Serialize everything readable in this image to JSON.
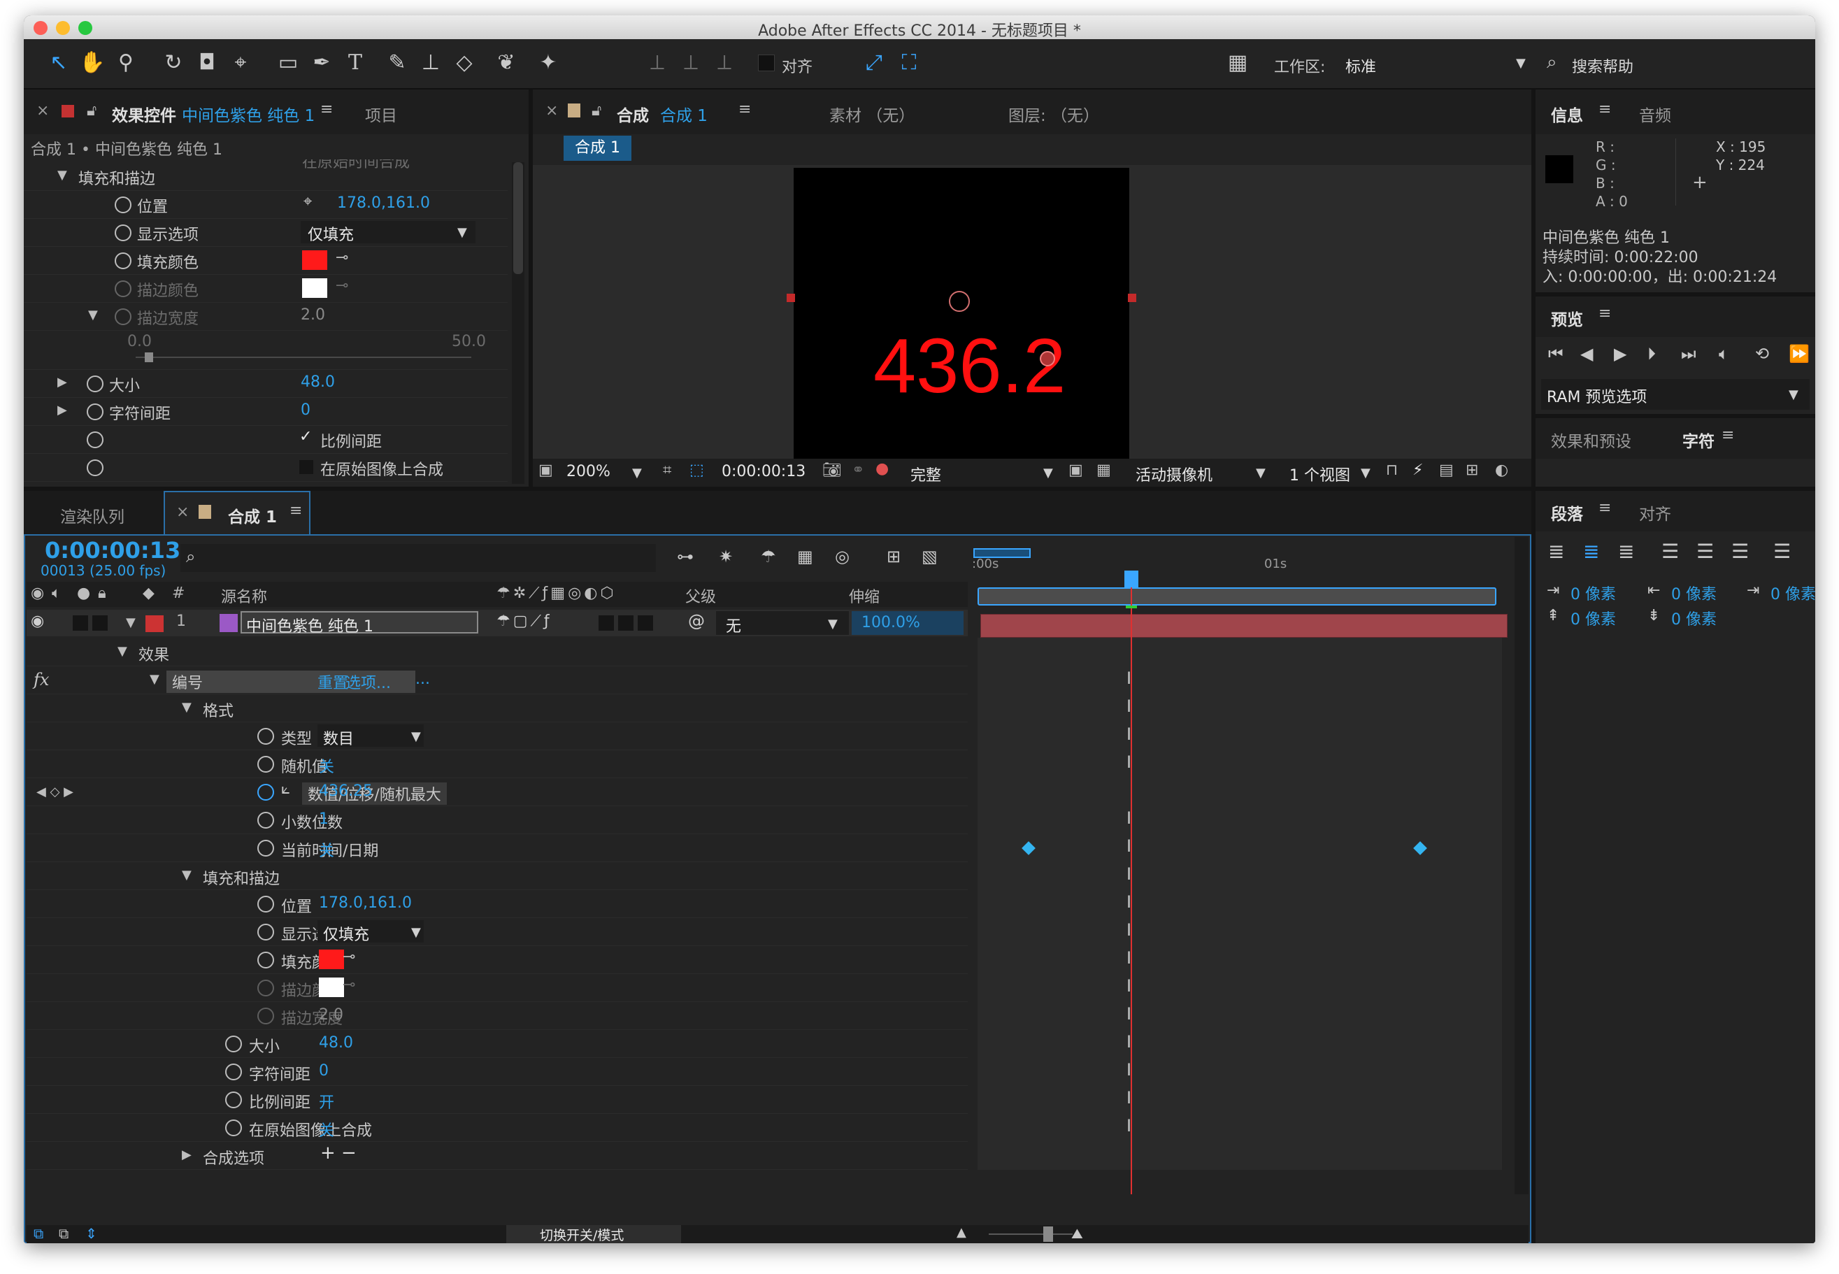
{
  "window": {
    "title": "Adobe After Effects CC 2014 - 无标题项目 *"
  },
  "toolbar": {
    "align_label": "对齐",
    "workspace_label": "工作区:",
    "workspace_value": "标准",
    "search_help": "搜索帮助"
  },
  "effect_controls": {
    "tab_label": "效果控件",
    "tab_layer": "中间色紫色 纯色 1",
    "tab_project": "项目",
    "breadcrumb": "合成 1 • 中间色紫色 纯色 1",
    "cut_text": "在原始时间合成",
    "section_fill_stroke": "填充和描边",
    "position_label": "位置",
    "position_value": "178.0,161.0",
    "display_label": "显示选项",
    "display_value": "仅填充",
    "fill_color_label": "填充颜色",
    "stroke_color_label": "描边颜色",
    "stroke_width_label": "描边宽度",
    "stroke_width_value": "2.0",
    "slider_min": "0.0",
    "slider_max": "50.0",
    "slider_value_fraction": 0.04,
    "size_label": "大小",
    "size_value": "48.0",
    "tracking_label": "字符间距",
    "tracking_value": "0",
    "proportional_label": "比例间距",
    "composite_label": "在原始图像上合成"
  },
  "composition": {
    "tab_label": "合成",
    "tab_name": "合成 1",
    "footage_tab": "素材 （无）",
    "layer_tab": "图层: （无）",
    "chip_label": "合成 1",
    "canvas_text": "436.2",
    "zoom": "200%",
    "timecode": "0:00:00:13",
    "quality": "完整",
    "camera": "活动摄像机",
    "views": "1 个视图"
  },
  "info_panel": {
    "tab_info": "信息",
    "tab_audio": "音频",
    "r_label": "R :",
    "g_label": "G :",
    "b_label": "B :",
    "a_label": "A : 0",
    "x_label": "X : 195",
    "y_label": "Y : 224",
    "layer_name": "中间色紫色 纯色 1",
    "duration": "持续时间: 0:00:22:00",
    "in_out": "入: 0:00:00:00，出: 0:00:21:24"
  },
  "preview_panel": {
    "tab_label": "预览",
    "ram_options": "RAM 预览选项"
  },
  "effects_presets": {
    "tab_label": "效果和预设",
    "tab_character": "字符"
  },
  "paragraph_panel": {
    "tab_label": "段落",
    "tab_align": "对齐",
    "indent_1": "0 像素",
    "indent_2": "0 像素",
    "indent_3": "0 像素",
    "space_1": "0 像素",
    "space_2": "0 像素"
  },
  "timeline": {
    "tab_render_queue": "渲染队列",
    "tab_comp": "合成 1",
    "timecode": "0:00:00:13",
    "frames": "00013 (25.00 fps)",
    "col_num": "#",
    "col_source": "源名称",
    "col_parent": "父级",
    "col_stretch": "伸缩",
    "layer_index": "1",
    "layer_name": "中间色紫色 纯色 1",
    "layer_parent": "无",
    "layer_stretch": "100.0%",
    "ruler_0": ":00s",
    "ruler_1": "01s",
    "toggle_modes": "切换开关/模式",
    "playhead_fraction": 0.295
  },
  "properties": [
    {
      "label": "效果",
      "value": "",
      "indent": 0,
      "twirl": "open",
      "stopwatch": false
    },
    {
      "label": "编号",
      "value": "",
      "indent": 1,
      "twirl": "open",
      "stopwatch": false,
      "selected": true,
      "links": [
        "重置",
        "选项...",
        "..."
      ]
    },
    {
      "label": "格式",
      "value": "",
      "indent": 2,
      "twirl": "open",
      "stopwatch": false
    },
    {
      "label": "类型",
      "value": "数目",
      "indent": 3,
      "stopwatch": true,
      "dropdown": true
    },
    {
      "label": "随机值",
      "value": "关",
      "indent": 3,
      "stopwatch": true
    },
    {
      "label": "数值/位移/随机最大",
      "value": "436.25",
      "indent": 3,
      "stopwatch": true,
      "keyframed": true
    },
    {
      "label": "小数位数",
      "value": "1",
      "indent": 3,
      "stopwatch": true
    },
    {
      "label": "当前时间/日期",
      "value": "关",
      "indent": 3,
      "stopwatch": true
    },
    {
      "label": "填充和描边",
      "value": "",
      "indent": 2,
      "twirl": "open",
      "stopwatch": false
    },
    {
      "label": "位置",
      "value": "178.0,161.0",
      "indent": 3,
      "stopwatch": true
    },
    {
      "label": "显示选项",
      "value": "仅填充",
      "indent": 3,
      "stopwatch": true,
      "dropdown": true
    },
    {
      "label": "填充颜色",
      "value": "",
      "indent": 3,
      "stopwatch": true,
      "swatch": "#ff1a1a"
    },
    {
      "label": "描边颜色",
      "value": "",
      "indent": 3,
      "stopwatch": true,
      "swatch": "#ffffff",
      "disabled": true
    },
    {
      "label": "描边宽度",
      "value": "2.0",
      "indent": 3,
      "stopwatch": true,
      "disabled": true
    },
    {
      "label": "大小",
      "value": "48.0",
      "indent": 2,
      "stopwatch": true
    },
    {
      "label": "字符间距",
      "value": "0",
      "indent": 2,
      "stopwatch": true
    },
    {
      "label": "比例间距",
      "value": "开",
      "indent": 2,
      "stopwatch": true
    },
    {
      "label": "在原始图像上合成",
      "value": "关",
      "indent": 2,
      "stopwatch": true
    },
    {
      "label": "合成选项",
      "value": "",
      "indent": 2,
      "twirl": "closed",
      "stopwatch": false,
      "addremove": true
    }
  ],
  "colors": {
    "accent_blue": "#2fa0e8",
    "layer_label": "#cc3333",
    "layer_bar": "#a0454b",
    "solid_purple": "#9b59c6",
    "playhead": "#e03030",
    "canvas_text": "#ff1010"
  }
}
